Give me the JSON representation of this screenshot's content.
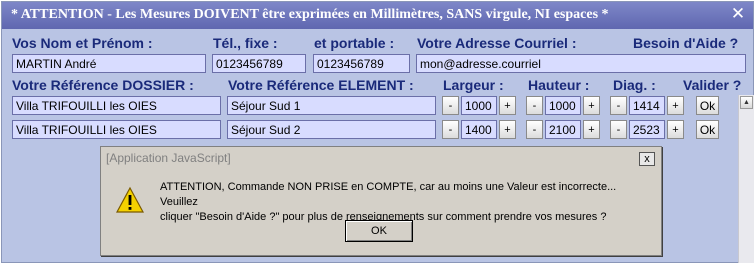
{
  "window": {
    "title": "* ATTENTION - Les Mesures DOIVENT être exprimées en Millimètres, SANS virgule, NI espaces *",
    "close_glyph": "✕"
  },
  "labels": {
    "nom": "Vos Nom et Prénom :",
    "tel_fixe": "Tél., fixe :",
    "portable": "et portable :",
    "courriel": "Votre Adresse Courriel :",
    "aide": "Besoin d'Aide ?",
    "dossier": "Votre Référence DOSSIER :",
    "element": "Votre Référence ELEMENT :",
    "largeur": "Largeur :",
    "hauteur": "Hauteur :",
    "diag": "Diag. :",
    "valider": "Valider ?"
  },
  "contact": {
    "nom": "MARTIN André",
    "tel_fixe": "0123456789",
    "portable": "0123456789",
    "courriel": "mon@adresse.courriel"
  },
  "rows": [
    {
      "dossier": "Villa TRIFOUILLI les OIES",
      "element": "Séjour Sud 1",
      "largeur": "1000",
      "hauteur": "1000",
      "diag": "1414"
    },
    {
      "dossier": "Villa TRIFOUILLI les OIES",
      "element": "Séjour Sud 2",
      "largeur": "1400",
      "hauteur": "2100",
      "diag": "2523"
    }
  ],
  "controls": {
    "minus": "-",
    "plus": "+",
    "ok": "Ok"
  },
  "dialog": {
    "title": "[Application JavaScript]",
    "close": "x",
    "message_line1": "ATTENTION, Commande NON PRISE en COMPTE, car au moins une Valeur est incorrecte... Veuillez",
    "message_line2": "cliquer \"Besoin d'Aide ?\" pour plus de renseignements sur comment prendre vos mesures ?",
    "ok_label": "OK",
    "warning_icon": "warning-triangle"
  },
  "scrollbar": {
    "up_glyph": "▲"
  },
  "colors": {
    "titlebar": "#6b73b8",
    "background": "#b9c4e4",
    "label": "#1a2a7a",
    "field": "#d8dcff",
    "dialog": "#d4d0c8"
  }
}
